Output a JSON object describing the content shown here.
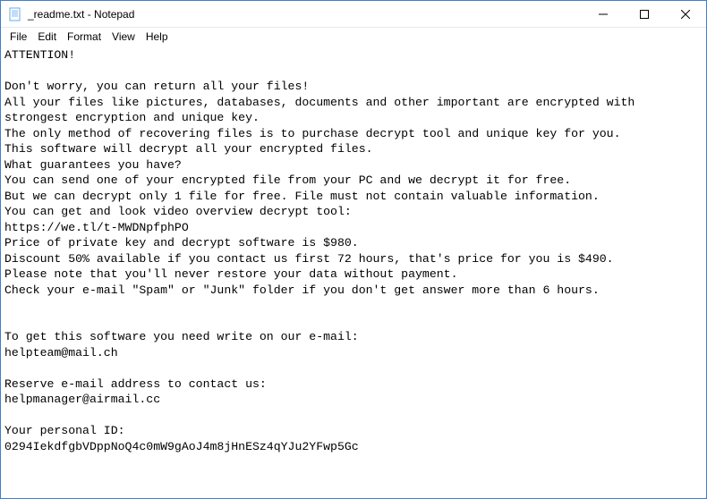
{
  "window": {
    "title": "_readme.txt - Notepad"
  },
  "menu": {
    "file": "File",
    "edit": "Edit",
    "format": "Format",
    "view": "View",
    "help": "Help"
  },
  "body": {
    "text": "ATTENTION!\n\nDon't worry, you can return all your files!\nAll your files like pictures, databases, documents and other important are encrypted with strongest encryption and unique key.\nThe only method of recovering files is to purchase decrypt tool and unique key for you.\nThis software will decrypt all your encrypted files.\nWhat guarantees you have?\nYou can send one of your encrypted file from your PC and we decrypt it for free.\nBut we can decrypt only 1 file for free. File must not contain valuable information.\nYou can get and look video overview decrypt tool:\nhttps://we.tl/t-MWDNpfphPO\nPrice of private key and decrypt software is $980.\nDiscount 50% available if you contact us first 72 hours, that's price for you is $490.\nPlease note that you'll never restore your data without payment.\nCheck your e-mail \"Spam\" or \"Junk\" folder if you don't get answer more than 6 hours.\n\n\nTo get this software you need write on our e-mail:\nhelpteam@mail.ch\n\nReserve e-mail address to contact us:\nhelpmanager@airmail.cc\n\nYour personal ID:\n0294IekdfgbVDppNoQ4c0mW9gAoJ4m8jHnESz4qYJu2YFwp5Gc"
  }
}
